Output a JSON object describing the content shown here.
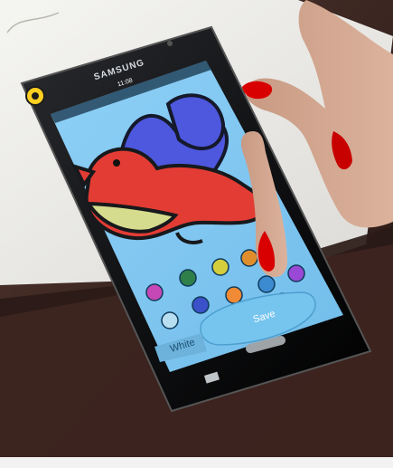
{
  "phone": {
    "brand": "SAMSUNG",
    "status_time": "11:08"
  },
  "app": {
    "palette_colors": [
      "#2f7f4a",
      "#d4cd3c",
      "#e08e2c",
      "#c548b6",
      "#3b51c9",
      "#f08a34",
      "#3c8bd0",
      "#9a48d6",
      "#b8def1",
      "#7e8fa2"
    ],
    "selected_color_label": "White",
    "save_label": "Save"
  }
}
